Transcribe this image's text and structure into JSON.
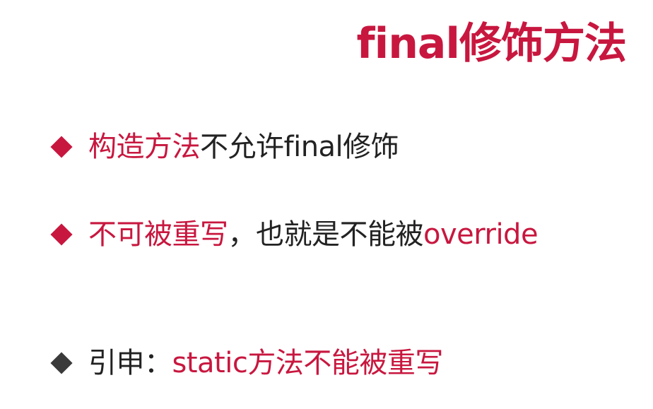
{
  "slide": {
    "title": "final修饰方法",
    "bullets": [
      {
        "highlight": "构造方法",
        "rest": "不允许final修饰"
      },
      {
        "highlight": "不可被重写",
        "middle": "，也就是不能被",
        "highlight2": "override"
      },
      {
        "lead": "引申：",
        "highlight": "static方法不能被重写"
      }
    ]
  },
  "colors": {
    "accent": "#c8173f",
    "text": "#222222",
    "dark_bullet": "#3a3a3a",
    "background": "#ffffff"
  }
}
